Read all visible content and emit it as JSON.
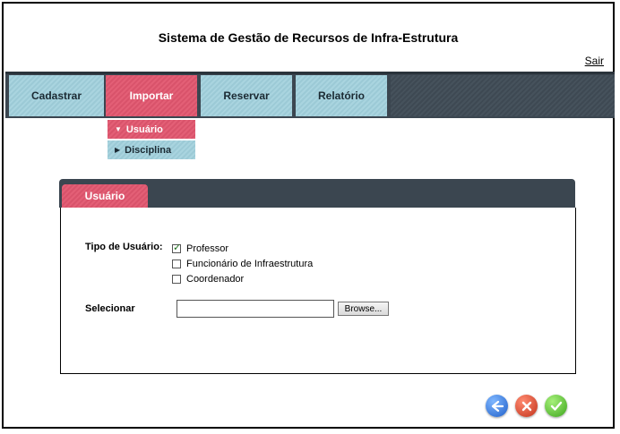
{
  "app": {
    "title": "Sistema de Gestão de Recursos de Infra-Estrutura",
    "logout_label": "Sair"
  },
  "nav": {
    "items": [
      {
        "label": "Cadastrar",
        "active": false
      },
      {
        "label": "Importar",
        "active": true
      },
      {
        "label": "Reservar",
        "active": false
      },
      {
        "label": "Relatório",
        "active": false
      }
    ],
    "submenu": [
      {
        "label": "Usuário",
        "selected": true
      },
      {
        "label": "Disciplina",
        "selected": false
      }
    ]
  },
  "panel": {
    "tab_label": "Usuário",
    "user_type_label": "Tipo de Usuário:",
    "options": [
      {
        "label": "Professor",
        "checked": true
      },
      {
        "label": "Funcionário de Infraestrutura",
        "checked": false
      },
      {
        "label": "Coordenador",
        "checked": false
      }
    ],
    "select_label": "Selecionar",
    "file_value": "",
    "browse_label": "Browse..."
  },
  "actions": {
    "back": "back-icon",
    "cancel": "cancel-icon",
    "confirm": "confirm-icon"
  },
  "colors": {
    "accent": "#e35f76",
    "nav_item": "#a9d4df",
    "nav_bg": "#3b4650"
  }
}
